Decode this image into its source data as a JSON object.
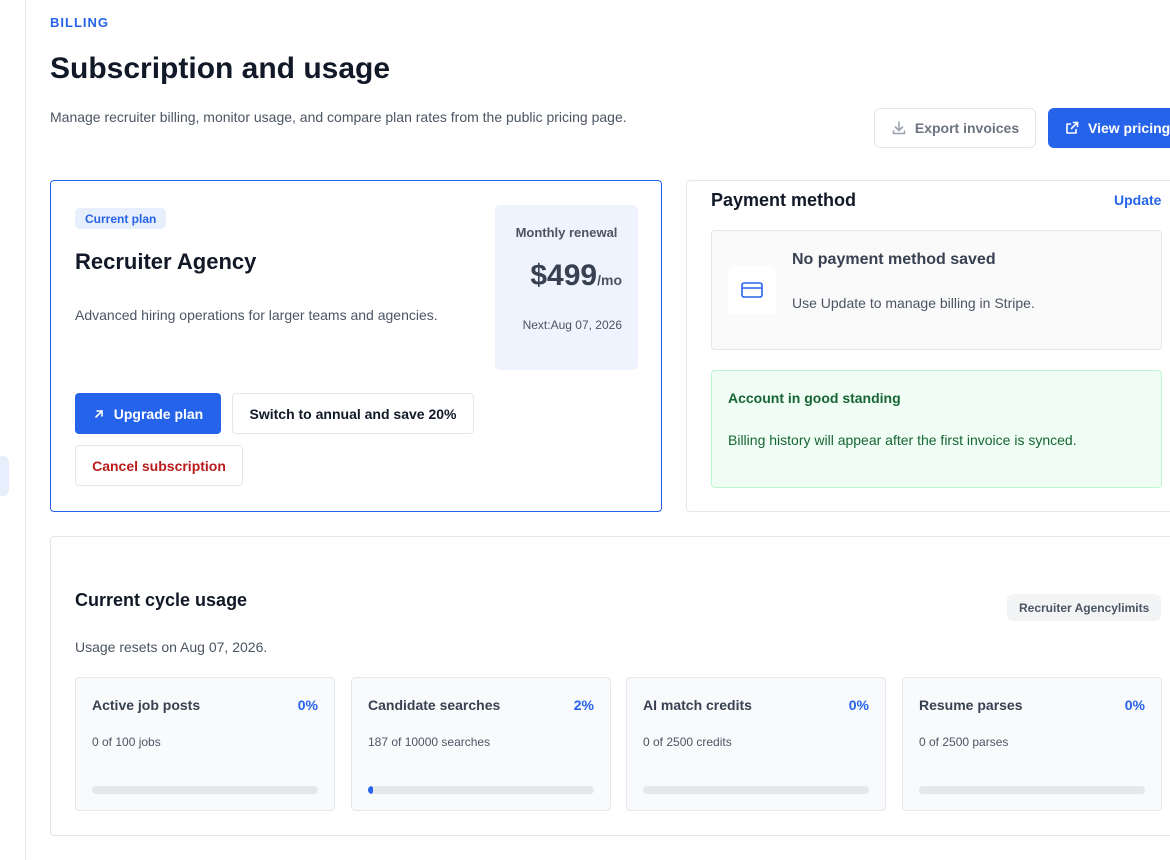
{
  "header": {
    "eyebrow": "BILLING",
    "title": "Subscription and usage",
    "subtitle": "Manage recruiter billing, monitor usage, and compare plan rates from the public pricing page.",
    "export_label": "Export invoices",
    "view_pricing_label": "View pricing"
  },
  "plan": {
    "badge": "Current plan",
    "name": "Recruiter Agency",
    "description": "Advanced hiring operations for larger teams and agencies.",
    "renewal_label": "Monthly renewal",
    "price": "$499",
    "price_unit": "/mo",
    "next_renewal": "Next:Aug 07, 2026",
    "upgrade_label": "Upgrade plan",
    "annual_label": "Switch to annual and save 20%",
    "cancel_label": "Cancel subscription"
  },
  "payment": {
    "title": "Payment method",
    "update_label": "Update",
    "empty_title": "No payment method saved",
    "empty_sub": "Use Update to manage billing in Stripe.",
    "standing_title": "Account in good standing",
    "standing_sub": "Billing history will appear after the first invoice is synced."
  },
  "usage": {
    "title": "Current cycle usage",
    "limits_chip": "Recruiter Agencylimits",
    "resets": "Usage resets on Aug 07, 2026.",
    "metrics": [
      {
        "label": "Active job posts",
        "percent": "0%",
        "detail": "0 of 100 jobs",
        "fraction": 0
      },
      {
        "label": "Candidate searches",
        "percent": "2%",
        "detail": "187 of 10000 searches",
        "fraction": 0.0187
      },
      {
        "label": "AI match credits",
        "percent": "0%",
        "detail": "0 of 2500 credits",
        "fraction": 0
      },
      {
        "label": "Resume parses",
        "percent": "0%",
        "detail": "0 of 2500 parses",
        "fraction": 0
      }
    ]
  },
  "colors": {
    "accent": "#2563eb",
    "danger": "#b91c1c",
    "success": "#166534"
  },
  "icons": {
    "export": "download-icon",
    "view_pricing": "external-link-icon",
    "upgrade": "arrow-up-right-icon",
    "payment": "credit-card-icon"
  }
}
